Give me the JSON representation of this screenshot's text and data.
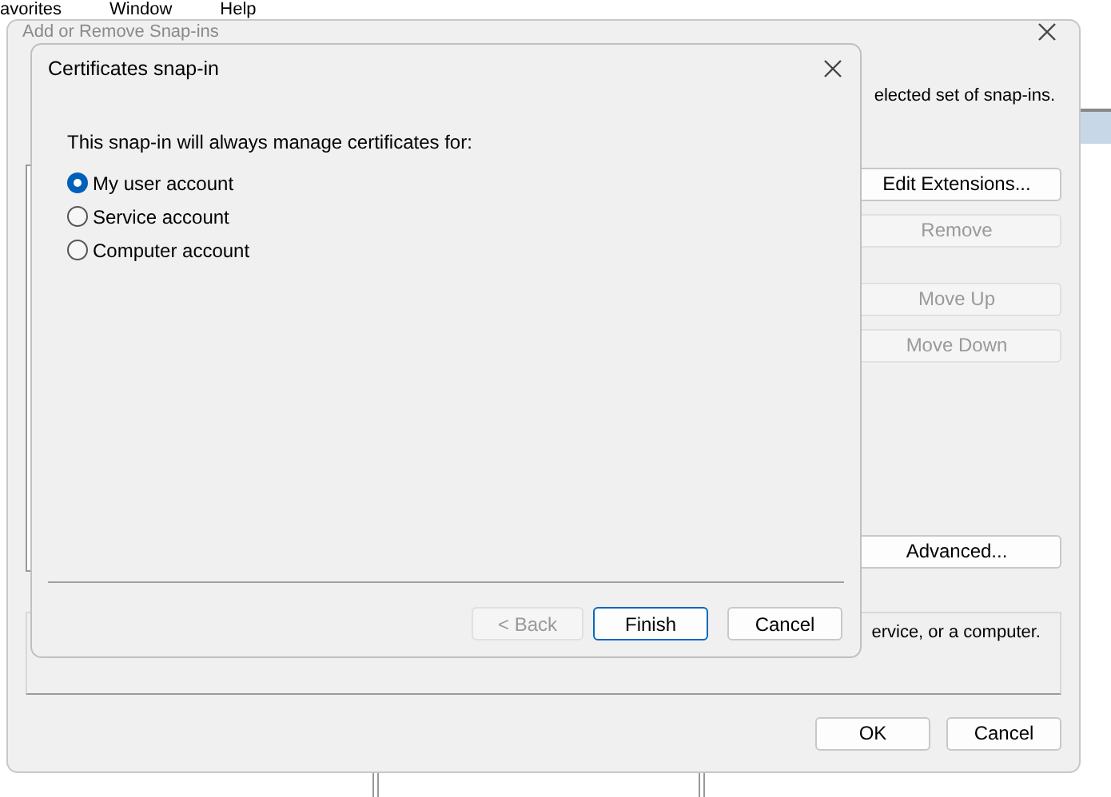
{
  "menu_bar": [
    "avorites",
    "Window",
    "Help"
  ],
  "back_dialog": {
    "title": "Add or Remove Snap-ins",
    "intro_line": "elected set of snap-ins.",
    "side_button_groups": [
      [
        {
          "label": "Edit Extensions...",
          "disabled": false
        },
        {
          "label": "Remove",
          "disabled": true
        }
      ],
      [
        {
          "label": "Move Up",
          "disabled": true
        },
        {
          "label": "Move Down",
          "disabled": true
        }
      ]
    ],
    "advanced_button": "Advanced...",
    "description_text": "ervice, or a computer.",
    "buttons": [
      "OK",
      "Cancel"
    ]
  },
  "front_dialog": {
    "title": "Certificates snap-in",
    "prompt": "This snap-in will always manage certificates for:",
    "options": [
      {
        "label": "My user account",
        "selected": true
      },
      {
        "label": "Service account",
        "selected": false
      },
      {
        "label": "Computer account",
        "selected": false
      }
    ],
    "buttons": [
      {
        "label": "< Back",
        "disabled": true,
        "default": false
      },
      {
        "label": "Finish",
        "disabled": false,
        "default": true
      },
      {
        "label": "Cancel",
        "disabled": false,
        "default": false
      }
    ]
  }
}
